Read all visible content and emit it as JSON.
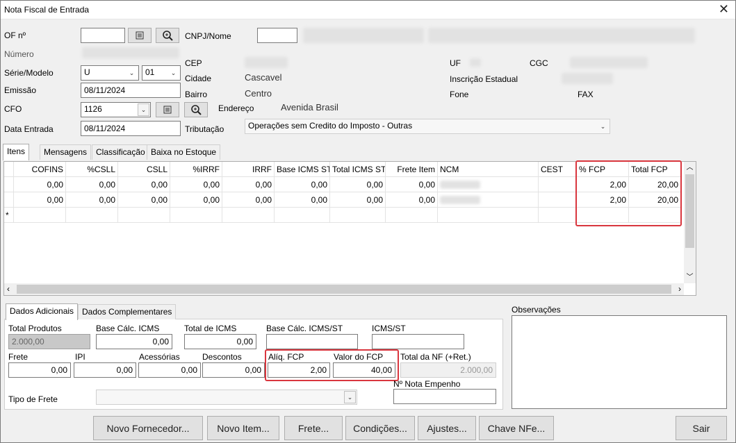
{
  "window": {
    "title": "Nota Fiscal de Entrada"
  },
  "header": {
    "of_label": "OF nº",
    "numero_label": "Número",
    "serie_label": "Série/Modelo",
    "serie_value": "U",
    "modelo_value": "01",
    "emissao_label": "Emissão",
    "emissao_value": "08/11/2024",
    "cfo_label": "CFO",
    "cfo_value": "1126",
    "data_entrada_label": "Data Entrada",
    "data_entrada_value": "08/11/2024",
    "cnpj_label": "CNPJ/Nome",
    "cep_label": "CEP",
    "cidade_label": "Cidade",
    "cidade_value": "Cascavel",
    "bairro_label": "Bairro",
    "bairro_value": "Centro",
    "endereco_label": "Endereço",
    "endereco_value": "Avenida Brasil",
    "tributacao_label": "Tributação",
    "tributacao_value": "Operações sem Credito do Imposto - Outras",
    "uf_label": "UF",
    "cgc_label": "CGC",
    "ie_label": "Inscrição Estadual",
    "fone_label": "Fone",
    "fax_label": "FAX"
  },
  "tabs": [
    "Itens",
    "Mensagens",
    "Classificação",
    "Baixa no Estoque"
  ],
  "grid": {
    "columns": [
      "COFINS",
      "%CSLL",
      "CSLL",
      "%IRRF",
      "IRRF",
      "Base ICMS ST",
      "Total ICMS ST",
      "Frete Item",
      "NCM",
      "CEST",
      "% FCP",
      "Total FCP"
    ],
    "rows": [
      [
        "0,00",
        "0,00",
        "0,00",
        "0,00",
        "0,00",
        "0,00",
        "0,00",
        "0,00",
        "",
        "",
        "2,00",
        "20,00"
      ],
      [
        "0,00",
        "0,00",
        "0,00",
        "0,00",
        "0,00",
        "0,00",
        "0,00",
        "0,00",
        "",
        "",
        "2,00",
        "20,00"
      ]
    ],
    "new_row_marker": "*"
  },
  "bottom_tabs": [
    "Dados Adicionais",
    "Dados Complementares"
  ],
  "totals": {
    "total_produtos_label": "Total Produtos",
    "total_produtos_value": "2.000,00",
    "base_icms_label": "Base Cálc. ICMS",
    "base_icms_value": "0,00",
    "total_icms_label": "Total de ICMS",
    "total_icms_value": "0,00",
    "base_icms_st_label": "Base Cálc. ICMS/ST",
    "icms_st_label": "ICMS/ST",
    "frete_label": "Frete",
    "frete_value": "0,00",
    "ipi_label": "IPI",
    "ipi_value": "0,00",
    "acessorias_label": "Acessórias",
    "acessorias_value": "0,00",
    "descontos_label": "Descontos",
    "descontos_value": "0,00",
    "aliq_fcp_label": "Alíq. FCP",
    "aliq_fcp_value": "2,00",
    "valor_fcp_label": "Valor do FCP",
    "valor_fcp_value": "40,00",
    "total_nf_label": "Total da NF (+Ret.)",
    "total_nf_value": "2.000,00",
    "nota_empenho_label": "Nº Nota Empenho",
    "tipo_frete_label": "Tipo de Frete"
  },
  "observacoes_label": "Observações",
  "buttons": {
    "novo_fornecedor": "Novo Fornecedor...",
    "novo_item": "Novo Item...",
    "frete": "Frete...",
    "condicoes": "Condições...",
    "ajustes": "Ajustes...",
    "chave_nfe": "Chave NFe...",
    "sair": "Sair"
  },
  "colors": {
    "highlight": "#d9363e"
  }
}
